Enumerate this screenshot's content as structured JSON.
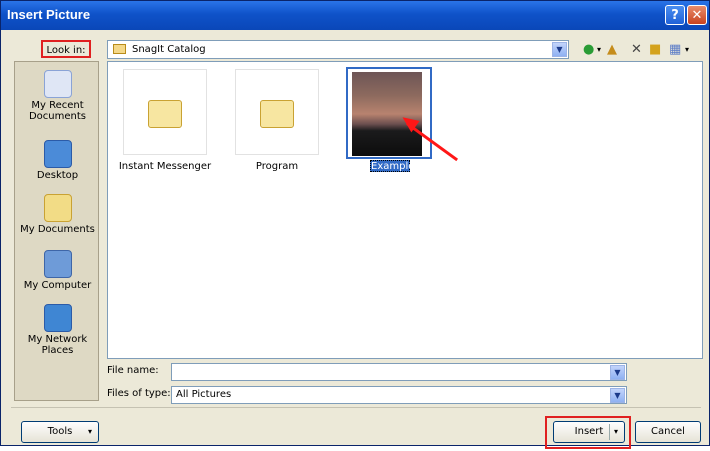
{
  "window": {
    "title": "Insert Picture",
    "help_glyph": "?",
    "close_glyph": "✕"
  },
  "lookin": {
    "label": "Look in:",
    "value": "SnagIt Catalog"
  },
  "toolbar": {
    "icons": [
      "back-icon",
      "up-folder-icon",
      "delete-icon",
      "new-folder-icon",
      "views-icon"
    ]
  },
  "places": [
    {
      "label": "My Recent Documents",
      "icon": "recent-documents-icon"
    },
    {
      "label": "Desktop",
      "icon": "desktop-icon"
    },
    {
      "label": "My Documents",
      "icon": "my-documents-icon"
    },
    {
      "label": "My Computer",
      "icon": "my-computer-icon"
    },
    {
      "label": "My Network Places",
      "icon": "network-places-icon"
    }
  ],
  "files": [
    {
      "name": "Instant Messenger",
      "type": "folder"
    },
    {
      "name": "Program",
      "type": "folder"
    },
    {
      "name": "Example",
      "type": "image",
      "selected": true
    }
  ],
  "filename": {
    "label": "File name:",
    "value": ""
  },
  "filetype": {
    "label": "Files of type:",
    "value": "All Pictures"
  },
  "buttons": {
    "tools": "Tools",
    "insert": "Insert",
    "cancel": "Cancel"
  },
  "colors": {
    "titlebar": "#0f52c9",
    "selection": "#316ac5",
    "annotation": "#ff1717"
  }
}
